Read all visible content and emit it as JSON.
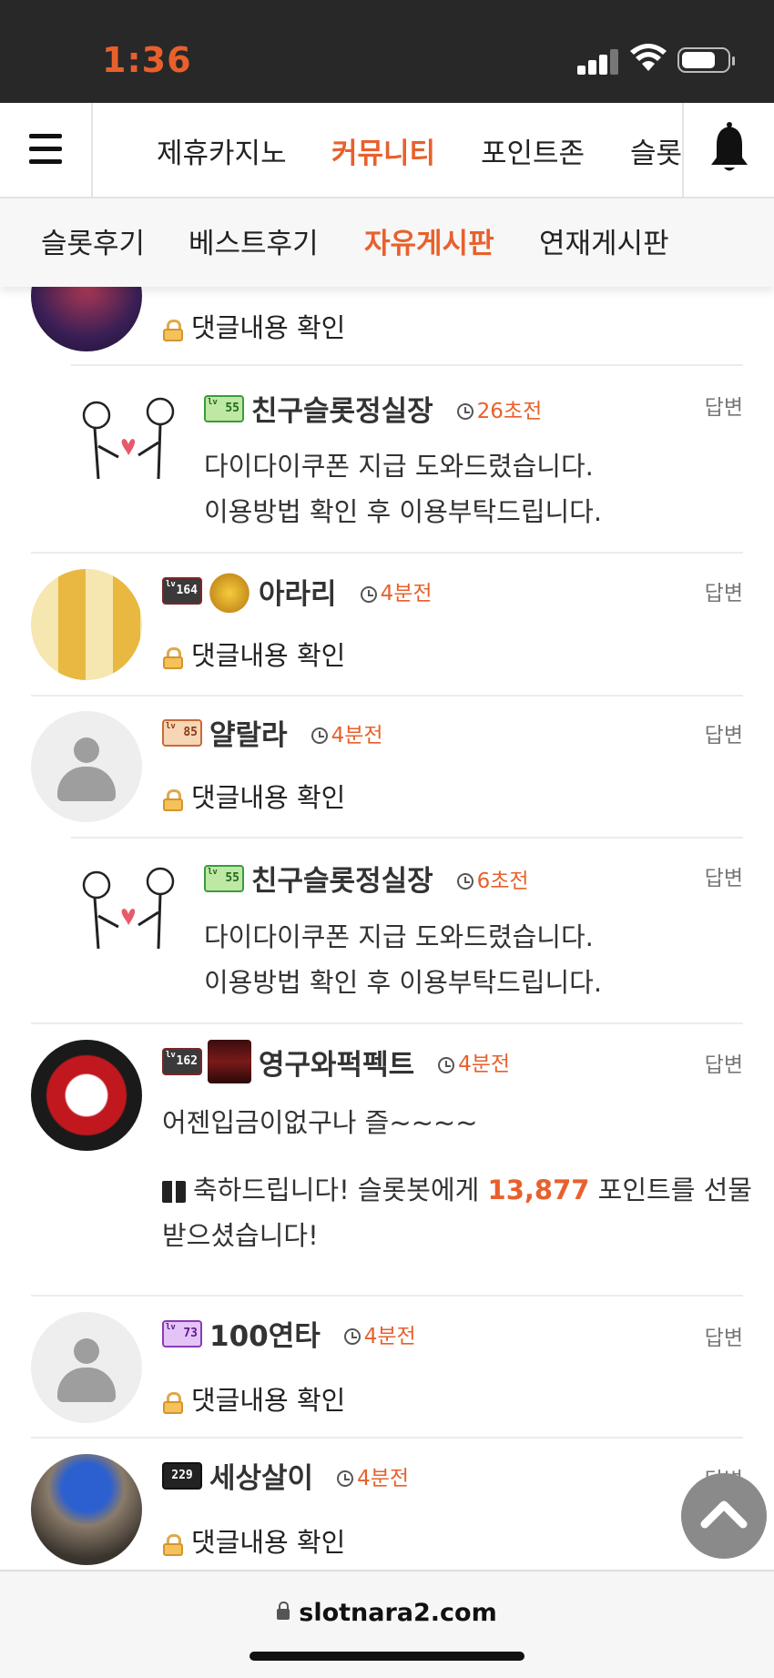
{
  "status_bar": {
    "time": "1:36"
  },
  "main_nav": {
    "tabs": [
      {
        "label": "제휴카지노",
        "active": false
      },
      {
        "label": "커뮤니티",
        "active": true
      },
      {
        "label": "포인트존",
        "active": false
      },
      {
        "label": "슬롯",
        "active": false
      }
    ]
  },
  "sub_nav": {
    "tabs": [
      {
        "label": "슬롯후기",
        "active": false
      },
      {
        "label": "베스트후기",
        "active": false
      },
      {
        "label": "자유게시판",
        "active": true
      },
      {
        "label": "연재게시판",
        "active": false
      }
    ]
  },
  "comments": [
    {
      "locked_text": "댓글내용 확인"
    },
    {
      "level": "55",
      "nickname": "친구슬롯정실장",
      "time": "26초전",
      "reply": "답변",
      "lines": [
        "다이다이쿠폰 지급 도와드렸습니다.",
        "이용방법 확인 후 이용부탁드립니다."
      ]
    },
    {
      "level": "164",
      "nickname": "아라리",
      "time": "4분전",
      "reply": "답변",
      "locked_text": "댓글내용 확인"
    },
    {
      "level": "85",
      "nickname": "얄랄라",
      "time": "4분전",
      "reply": "답변",
      "locked_text": "댓글내용 확인"
    },
    {
      "level": "55",
      "nickname": "친구슬롯정실장",
      "time": "6초전",
      "reply": "답변",
      "lines": [
        "다이다이쿠폰 지급 도와드렸습니다.",
        "이용방법 확인 후 이용부탁드립니다."
      ]
    },
    {
      "level": "162",
      "nickname": "영구와퍽펙트",
      "time": "4분전",
      "reply": "답변",
      "text": "어젠입금이없구나 즐~~~~",
      "gift_pre": "축하드립니다! 슬롯봇에게 ",
      "gift_points": "13,877",
      "gift_post": " 포인트를 선물",
      "gift_line2": "받으셨습니다!"
    },
    {
      "level": "73",
      "nickname": "100연타",
      "time": "4분전",
      "reply": "답변",
      "locked_text": "댓글내용 확인"
    },
    {
      "level": "229",
      "nickname": "세상살이",
      "time": "4분전",
      "reply": "답변",
      "locked_text": "댓글내용 확인"
    }
  ],
  "url_bar": {
    "domain": "slotnara2.com"
  },
  "colors": {
    "accent": "#e8602c",
    "lock": "#f4c15a"
  }
}
